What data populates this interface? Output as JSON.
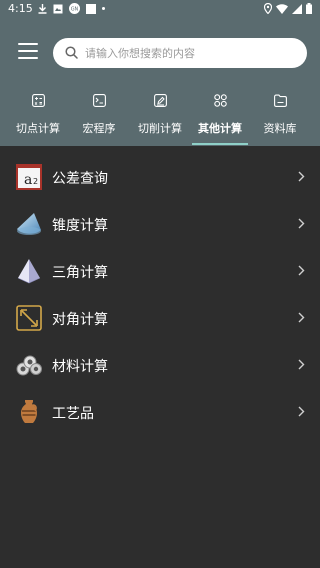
{
  "status_bar": {
    "time": "4:15",
    "icons": [
      "download-icon",
      "image-icon",
      "gn-icon",
      "square-icon",
      "dot-icon",
      "location-icon",
      "wifi-icon",
      "signal-icon",
      "battery-icon"
    ]
  },
  "header": {
    "menu_icon": "hamburger-icon",
    "search": {
      "icon": "search-icon",
      "placeholder": "请输入你想搜索的内容"
    }
  },
  "tabs": [
    {
      "label": "切点计算",
      "icon": "calculator-icon",
      "active": false
    },
    {
      "label": "宏程序",
      "icon": "terminal-icon",
      "active": false
    },
    {
      "label": "切削计算",
      "icon": "edit-icon",
      "active": false
    },
    {
      "label": "其他计算",
      "icon": "grid-icon",
      "active": true
    },
    {
      "label": "资料库",
      "icon": "folder-icon",
      "active": false
    }
  ],
  "items": [
    {
      "label": "公差查询",
      "icon": "a2-tolerance-icon"
    },
    {
      "label": "锥度计算",
      "icon": "cone-icon"
    },
    {
      "label": "三角计算",
      "icon": "pyramid-icon"
    },
    {
      "label": "对角计算",
      "icon": "diagonal-arrow-icon"
    },
    {
      "label": "材料计算",
      "icon": "pipes-icon"
    },
    {
      "label": "工艺品",
      "icon": "vase-icon"
    }
  ],
  "colors": {
    "header_bg": "#5a6b6f",
    "body_bg": "#2d2d2d",
    "tab_underline": "#8fd0c8"
  }
}
